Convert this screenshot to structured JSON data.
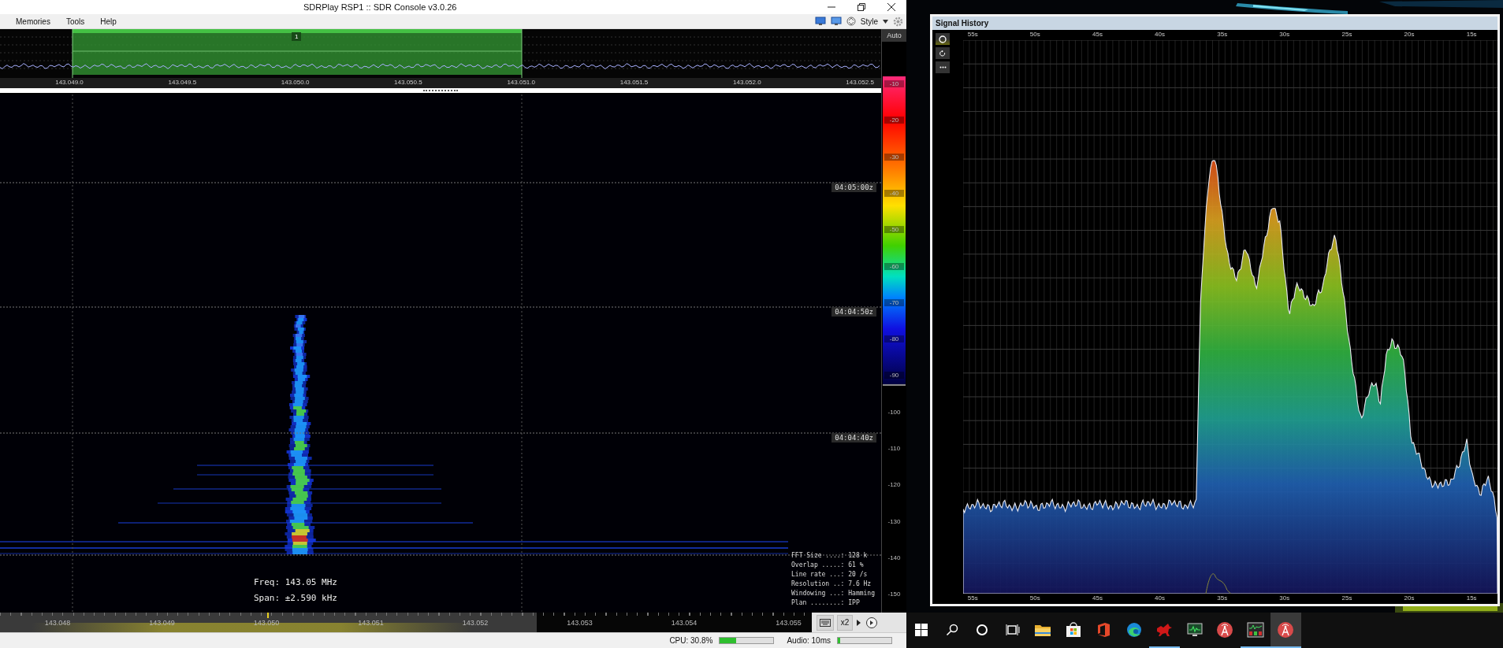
{
  "window": {
    "title": "SDRPlay RSP1 :: SDR Console v3.0.26"
  },
  "menu": [
    {
      "label": "Memories"
    },
    {
      "label": "Tools"
    },
    {
      "label": "Help"
    }
  ],
  "toolbar": {
    "style_label": "Style"
  },
  "spectrum": {
    "auto_label": "Auto",
    "band_label": "1",
    "freq_labels": [
      "143.049.0",
      "143.049.5",
      "143.050.0",
      "143.050.5",
      "143.051.0",
      "143.051.5",
      "143.052.0",
      "143.052.5"
    ]
  },
  "waterfall": {
    "time_labels": [
      "04:05:00z",
      "04:04:50z",
      "04:04:40z"
    ],
    "freq": "Freq: 143.05 MHz",
    "span": "Span: ±2.590 kHz",
    "stats": [
      "FFT Size ....: 128 k",
      "Overlap .....: 61 %",
      "Line rate ...: 20 /s",
      "Resolution ..: 7.6 Hz",
      "Windowing ...: Hamming",
      "Plan ........: IPP"
    ]
  },
  "color_scale": {
    "labels": [
      "-10",
      "-20",
      "-30",
      "-40",
      "-50",
      "-60",
      "-70",
      "-80",
      "-90",
      "-100",
      "-110",
      "-120",
      "-130",
      "-140",
      "-150"
    ]
  },
  "tuning_bar": {
    "freq_labels": [
      "143.048",
      "143.049",
      "143.050",
      "143.051",
      "143.052",
      "143.053",
      "143.054",
      "143.055"
    ],
    "zoom": "x2"
  },
  "status_bar": {
    "cpu": {
      "text": "CPU: 30.8%",
      "level": 0.3
    },
    "audio": {
      "text": "Audio: 10ms",
      "level": 0.05
    }
  },
  "signal_history": {
    "title": "Signal History",
    "top_ticks": [
      "55s",
      "50s",
      "45s",
      "40s",
      "35s",
      "30s",
      "25s",
      "20s",
      "15s"
    ],
    "bottom_ticks": [
      "55s",
      "50s",
      "45s",
      "40s",
      "35s",
      "30s",
      "25s",
      "20s",
      "15s"
    ]
  },
  "taskbar": {
    "items": [
      {
        "kind": "start",
        "running": false,
        "selected": false
      },
      {
        "kind": "search",
        "running": false,
        "selected": false
      },
      {
        "kind": "cortana",
        "running": false,
        "selected": false
      },
      {
        "kind": "taskview",
        "running": false,
        "selected": false
      },
      {
        "kind": "folder",
        "running": false,
        "selected": false
      },
      {
        "kind": "store",
        "running": false,
        "selected": false
      },
      {
        "kind": "office",
        "running": false,
        "selected": false
      },
      {
        "kind": "browser",
        "running": false,
        "selected": false
      },
      {
        "kind": "bird",
        "running": true,
        "selected": false
      },
      {
        "kind": "monitor",
        "running": false,
        "selected": false
      },
      {
        "kind": "antenna",
        "running": false,
        "selected": false
      },
      {
        "kind": "dashboard",
        "running": true,
        "selected": false
      },
      {
        "kind": "antenna",
        "running": true,
        "selected": true
      }
    ]
  }
}
